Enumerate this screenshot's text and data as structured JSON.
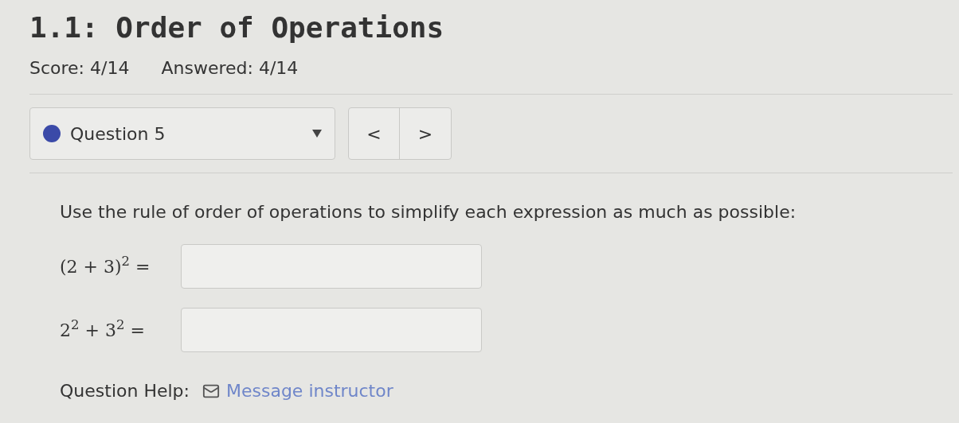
{
  "title": "1.1: Order of Operations",
  "score": {
    "score": "Score: 4/14",
    "answered": "Answered: 4/14"
  },
  "question_select": {
    "label": "Question 5"
  },
  "nav": {
    "prev": "<",
    "next": ">"
  },
  "prompt": "Use the rule of order of operations to simplify each expression as much as possible:",
  "expressions": [
    {
      "expression": "(2 + 3)$^{2}$ ="
    },
    {
      "expression": "2$^{2}$ + 3$^{2}$ ="
    }
  ],
  "help": {
    "label": "Question Help:",
    "link": "Message instructor"
  }
}
